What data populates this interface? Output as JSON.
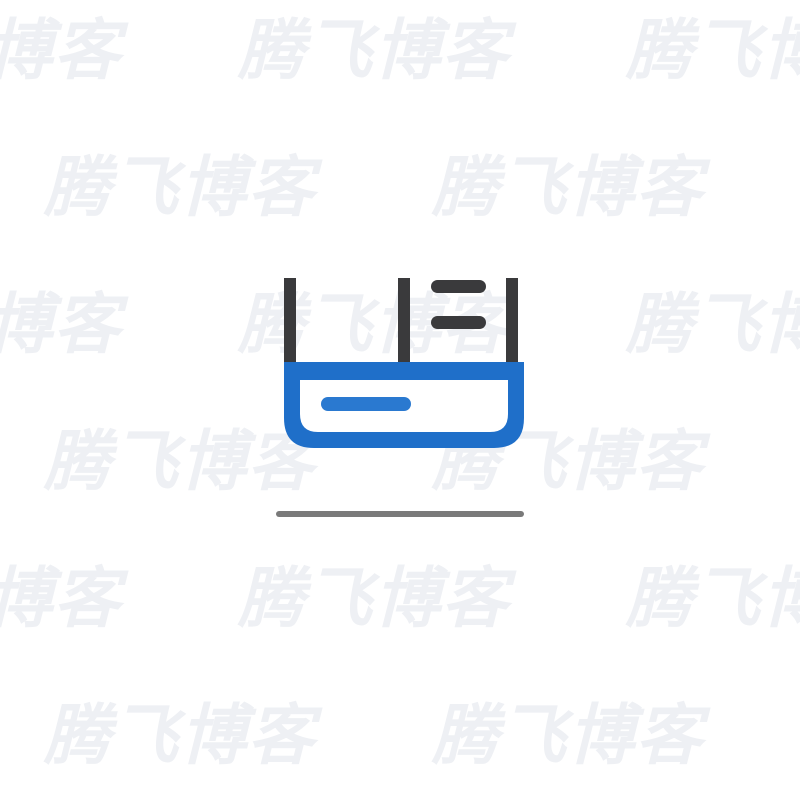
{
  "watermark": {
    "text": "腾飞博客",
    "color": "#eef0f4"
  },
  "icon": {
    "name": "app-window-icon",
    "colors": {
      "frame": "#3a3a3c",
      "accent": "#1f6fc9",
      "accent_bar": "#ffffff",
      "bar_inner": "#2a79d0",
      "underline": "#7a7a7a"
    }
  }
}
